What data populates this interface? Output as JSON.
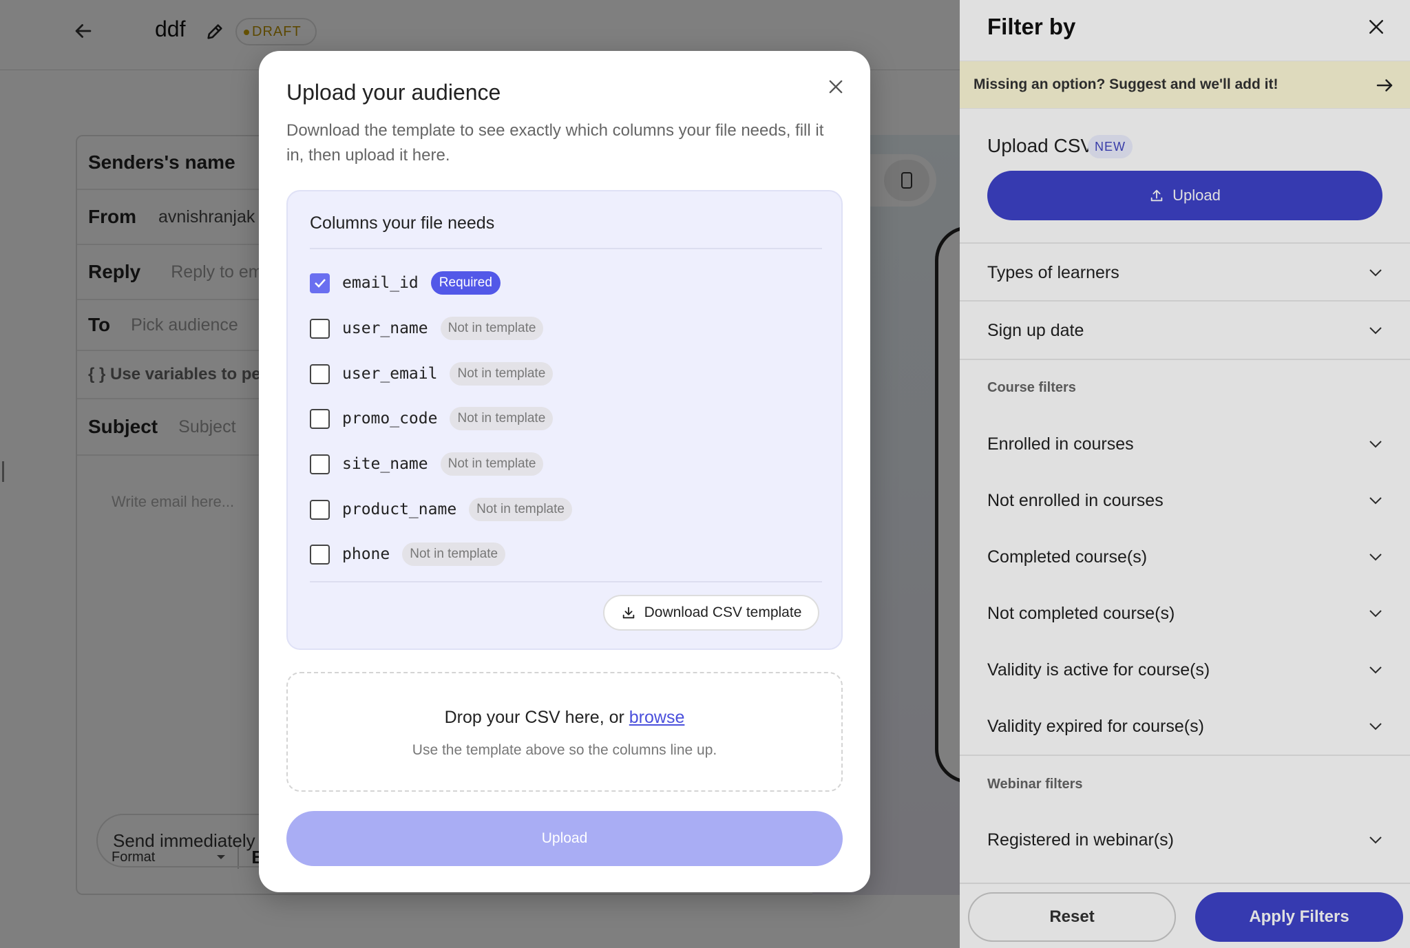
{
  "page": {
    "title": "ddf",
    "status_badge": "DRAFT",
    "composer": {
      "sender_label": "Senders's name",
      "from_label": "From",
      "from_value": "avnishranjak",
      "reply_label": "Reply",
      "reply_placeholder": "Reply to em",
      "to_label": "To",
      "to_placeholder": "Pick audience",
      "variables_hint": "{ } Use variables to pe",
      "subject_label": "Subject",
      "subject_placeholder": "Subject",
      "body_placeholder": "Write email here...",
      "format_label": "Format",
      "bold_label": "B",
      "send_option": "Send immediately"
    }
  },
  "modal": {
    "title": "Upload your audience",
    "description": "Download the template to see exactly which columns your file needs, fill it in, then upload it here.",
    "columns_title": "Columns your file needs",
    "columns": [
      {
        "name": "email_id",
        "checked": true,
        "tag": "Required"
      },
      {
        "name": "user_name",
        "checked": false,
        "tag": "Not in template"
      },
      {
        "name": "user_email",
        "checked": false,
        "tag": "Not in template"
      },
      {
        "name": "promo_code",
        "checked": false,
        "tag": "Not in template"
      },
      {
        "name": "site_name",
        "checked": false,
        "tag": "Not in template"
      },
      {
        "name": "product_name",
        "checked": false,
        "tag": "Not in template"
      },
      {
        "name": "phone",
        "checked": false,
        "tag": "Not in template"
      }
    ],
    "download_label": "Download CSV template",
    "drop_text": "Drop your CSV here, or",
    "browse_label": "browse",
    "drop_hint": "Use the template above so the columns line up.",
    "upload_label": "Upload"
  },
  "filter_panel": {
    "title": "Filter by",
    "suggest_text": "Missing an option? Suggest and we'll add it!",
    "upload_csv_title": "Upload CSV",
    "new_badge": "NEW",
    "upload_label": "Upload",
    "items_general": [
      "Types of learners",
      "Sign up date"
    ],
    "course_section": "Course filters",
    "items_course": [
      "Enrolled in courses",
      "Not enrolled in courses",
      "Completed course(s)",
      "Not completed course(s)",
      "Validity is active for course(s)",
      "Validity expired for course(s)"
    ],
    "webinar_section": "Webinar filters",
    "items_webinar": [
      "Registered in webinar(s)"
    ],
    "reset_label": "Reset",
    "apply_label": "Apply Filters"
  },
  "colors": {
    "accent": "#3e43c9",
    "required_tag": "#5258e8",
    "upload_disabled": "#a9adf4",
    "draft": "#b89000",
    "suggest_bg": "#fdf9d8"
  }
}
